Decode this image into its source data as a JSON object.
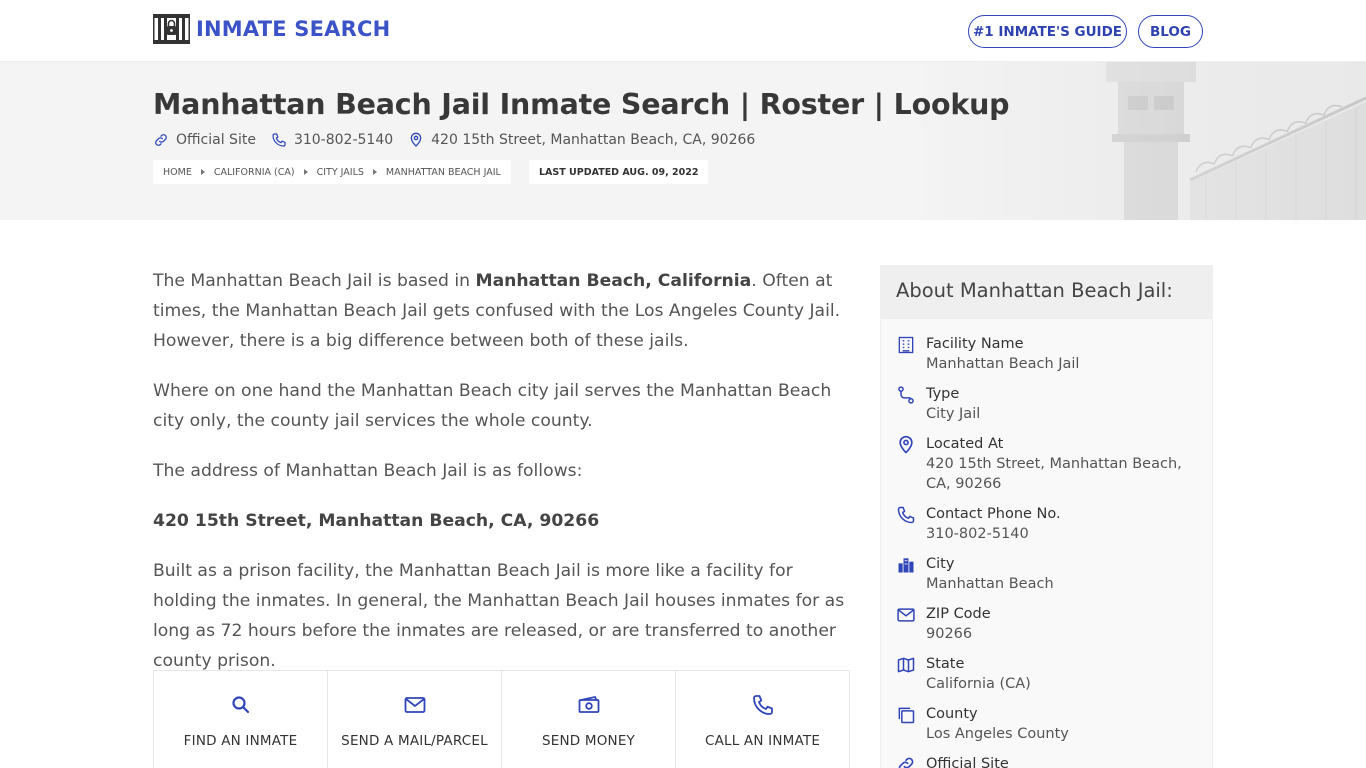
{
  "header": {
    "logo_text": "INMATE SEARCH",
    "nav": [
      {
        "label": "#1 INMATE'S GUIDE"
      },
      {
        "label": "BLOG"
      }
    ]
  },
  "hero": {
    "title": "Manhattan Beach Jail Inmate Search | Roster | Lookup",
    "official_site": "Official Site",
    "phone": "310-802-5140",
    "address": "420 15th Street, Manhattan Beach, CA, 90266",
    "breadcrumb": [
      "HOME",
      "CALIFORNIA (CA)",
      "CITY JAILS",
      "MANHATTAN BEACH JAIL"
    ],
    "last_updated": "LAST UPDATED AUG. 09, 2022"
  },
  "article": {
    "p1_a": "The Manhattan Beach Jail is based in ",
    "p1_bold": "Manhattan Beach, California",
    "p1_b": ". Often at times, the Manhattan Beach Jail gets confused with the Los Angeles County Jail. However, there is a big difference between both of these jails.",
    "p2": "Where on one hand the Manhattan Beach city jail serves the Manhattan Beach city only, the county jail services the whole county.",
    "p3": "The address of Manhattan Beach Jail is as follows:",
    "p4_bold": "420 15th Street, Manhattan Beach, CA, 90266",
    "p5": "Built as a prison facility, the Manhattan Beach Jail is more like a facility for holding the inmates. In general, the Manhattan Beach Jail houses inmates for as long as 72 hours before the inmates are released, or are transferred to another county prison."
  },
  "actions": [
    {
      "label": "FIND AN INMATE",
      "icon": "search-icon"
    },
    {
      "label": "SEND A MAIL/PARCEL",
      "icon": "mail-icon"
    },
    {
      "label": "SEND MONEY",
      "icon": "money-icon"
    },
    {
      "label": "CALL AN INMATE",
      "icon": "phone-icon"
    }
  ],
  "sidebar": {
    "title": "About Manhattan Beach Jail:",
    "facts": [
      {
        "label": "Facility Name",
        "value": "Manhattan Beach Jail",
        "icon": "building-icon"
      },
      {
        "label": "Type",
        "value": "City Jail",
        "icon": "route-icon"
      },
      {
        "label": "Located At",
        "value": "420 15th Street, Manhattan Beach, CA, 90266",
        "icon": "map-pin-icon"
      },
      {
        "label": "Contact Phone No.",
        "value": "310-802-5140",
        "icon": "phone-icon"
      },
      {
        "label": "City",
        "value": "Manhattan Beach",
        "icon": "city-icon"
      },
      {
        "label": "ZIP Code",
        "value": "90266",
        "icon": "mail-icon"
      },
      {
        "label": "State",
        "value": "California (CA)",
        "icon": "map-icon"
      },
      {
        "label": "County",
        "value": "Los Angeles County",
        "icon": "copy-icon"
      },
      {
        "label": "Official Site",
        "value": "",
        "icon": "link-icon"
      }
    ]
  },
  "colors": {
    "brand": "#3b53c7",
    "icon": "#3046b8",
    "hero_bg": "#f4f4f4",
    "sidebar_head_bg": "#efefef"
  }
}
